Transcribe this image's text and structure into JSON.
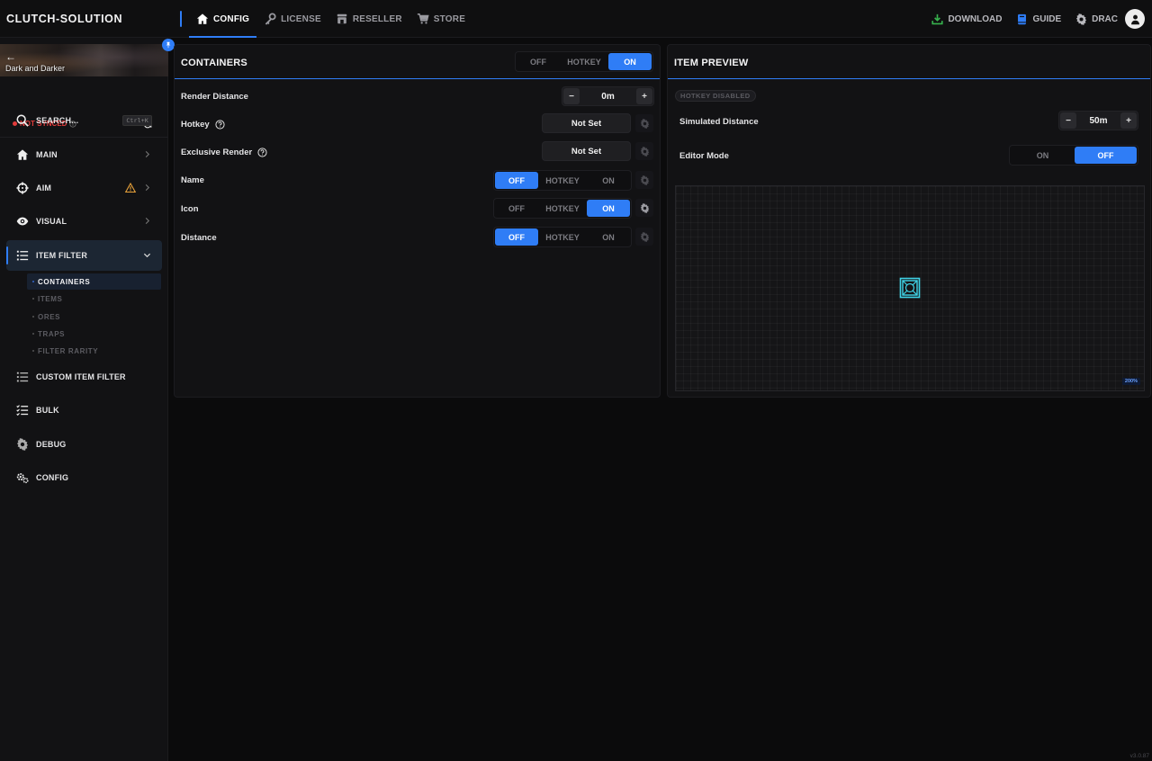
{
  "app": {
    "brand": "CLUTCH-SOLUTION",
    "version": "v3.0.87"
  },
  "nav": {
    "tabs": [
      {
        "label": "CONFIG",
        "icon": "home-icon",
        "active": true
      },
      {
        "label": "LICENSE",
        "icon": "key-icon",
        "active": false
      },
      {
        "label": "RESELLER",
        "icon": "store-icon",
        "active": false
      },
      {
        "label": "STORE",
        "icon": "cart-icon",
        "active": false
      }
    ],
    "right": {
      "download": "DOWNLOAD",
      "guide": "GUIDE",
      "user": "DRAC"
    }
  },
  "sidebar": {
    "game_title": "Dark and Darker",
    "sync_status": "NOT SYNCED",
    "search_label": "SEARCH...",
    "search_shortcut": "Ctrl+K",
    "items": [
      {
        "label": "MAIN",
        "icon": "home-icon"
      },
      {
        "label": "AIM",
        "icon": "crosshair-icon",
        "warning": true
      },
      {
        "label": "VISUAL",
        "icon": "eye-icon"
      },
      {
        "label": "ITEM FILTER",
        "icon": "list-icon",
        "active": true,
        "expanded": true
      },
      {
        "label": "CUSTOM ITEM FILTER",
        "icon": "list-icon"
      },
      {
        "label": "BULK",
        "icon": "checklist-icon"
      },
      {
        "label": "DEBUG",
        "icon": "gear-icon"
      },
      {
        "label": "CONFIG",
        "icon": "gears-icon"
      }
    ],
    "subitems": [
      {
        "label": "CONTAINERS",
        "active": true
      },
      {
        "label": "ITEMS"
      },
      {
        "label": "ORES"
      },
      {
        "label": "TRAPS"
      },
      {
        "label": "FILTER RARITY"
      }
    ]
  },
  "containers": {
    "title": "CONTAINERS",
    "master_toggle": {
      "options": [
        "OFF",
        "HOTKEY",
        "ON"
      ],
      "selected": "ON"
    },
    "rows": {
      "render_distance": {
        "label": "Render Distance",
        "value": "0m"
      },
      "hotkey": {
        "label": "Hotkey",
        "value": "Not Set"
      },
      "exclusive_render": {
        "label": "Exclusive Render",
        "value": "Not Set"
      },
      "name": {
        "label": "Name",
        "options": [
          "OFF",
          "HOTKEY",
          "ON"
        ],
        "selected": "OFF"
      },
      "icon": {
        "label": "Icon",
        "options": [
          "OFF",
          "HOTKEY",
          "ON"
        ],
        "selected": "ON"
      },
      "distance": {
        "label": "Distance",
        "options": [
          "OFF",
          "HOTKEY",
          "ON"
        ],
        "selected": "OFF"
      }
    }
  },
  "preview": {
    "title": "ITEM PREVIEW",
    "badge": "HOTKEY DISABLED",
    "simulated_distance": {
      "label": "Simulated Distance",
      "value": "50m"
    },
    "editor_mode": {
      "label": "Editor Mode",
      "options": [
        "ON",
        "OFF"
      ],
      "selected": "OFF"
    },
    "tag": "200%"
  },
  "colors": {
    "accent": "#2f7df6",
    "warning": "#e8a23a",
    "danger": "#e23b3b",
    "preview_icon": "#3fd2e6"
  }
}
